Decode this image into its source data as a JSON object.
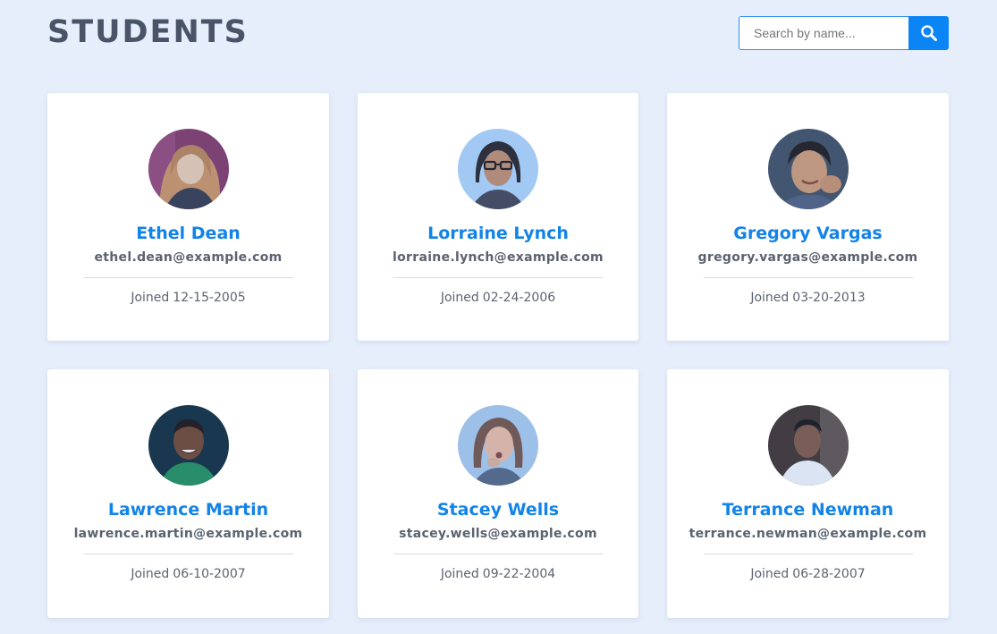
{
  "header": {
    "title": "STUDENTS"
  },
  "search": {
    "placeholder": "Search by name...",
    "value": "",
    "icon": "search-icon"
  },
  "colors": {
    "background": "#e6eefb",
    "accent": "#0b84f5",
    "name": "#1283e7",
    "title": "#4a5468"
  },
  "joined_prefix": "Joined",
  "students": [
    {
      "name": "Ethel Dean",
      "email": "ethel.dean@example.com",
      "joined": "12-15-2005"
    },
    {
      "name": "Lorraine Lynch",
      "email": "lorraine.lynch@example.com",
      "joined": "02-24-2006"
    },
    {
      "name": "Gregory Vargas",
      "email": "gregory.vargas@example.com",
      "joined": "03-20-2013"
    },
    {
      "name": "Lawrence Martin",
      "email": "lawrence.martin@example.com",
      "joined": "06-10-2007"
    },
    {
      "name": "Stacey Wells",
      "email": "stacey.wells@example.com",
      "joined": "09-22-2004"
    },
    {
      "name": "Terrance Newman",
      "email": "terrance.newman@example.com",
      "joined": "06-28-2007"
    }
  ]
}
